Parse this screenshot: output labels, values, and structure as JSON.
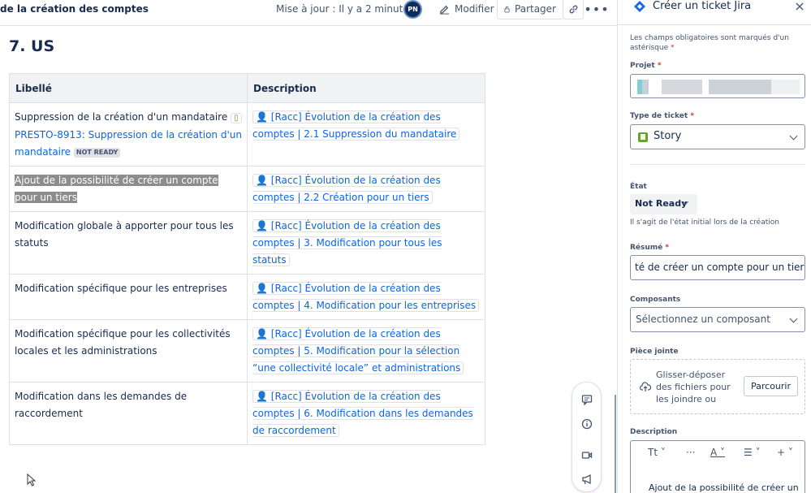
{
  "topbar": {
    "breadcrumb": "de la création des comptes",
    "updated": "Mise à jour : Il y a 2 minutes",
    "avatar_initials": "PN",
    "edit_label": "Modifier",
    "share_label": "Partager"
  },
  "section_title": "7. US",
  "table": {
    "headers": [
      "Libellé",
      "Description"
    ],
    "rows": [
      {
        "label": "Suppression de la création d'un mandataire",
        "ticket": "PRESTO-8913: Suppression de la création d'un mandataire",
        "ticket_status": "NOT READY",
        "desc_link": "👤 [Racc] Évolution de la création des comptes | 2.1 Suppression du mandataire"
      },
      {
        "label": "Ajout de la possibilité de créer un compte pour un tiers",
        "desc_link": "👤 [Racc] Évolution de la création des comptes | 2.2 Création pour un tiers"
      },
      {
        "label": "Modification globale à apporter pour tous les statuts",
        "desc_link": "👤 [Racc] Évolution de la création des comptes | 3. Modification pour tous les statuts"
      },
      {
        "label": "Modification spécifique pour les entreprises",
        "desc_link": "👤 [Racc] Évolution de la création des comptes | 4. Modification pour les entreprises"
      },
      {
        "label": "Modification spécifique pour les collectivités locales et les administrations",
        "desc_link": "👤 [Racc] Évolution de la création des comptes | 5. Modification pour la sélection “une collectivité locale” et administrations"
      },
      {
        "label": "Modification dans les demandes de raccordement",
        "desc_link": "👤 [Racc] Évolution de la création des comptes | 6. Modification dans les demandes de raccordement"
      }
    ]
  },
  "panel": {
    "title": "Créer un ticket Jira",
    "required_note": "Les champs obligatoires sont marqués d'un astérisque",
    "asterisk": "*",
    "project_label": "Projet",
    "ticket_type_label": "Type de ticket",
    "ticket_type_value": "Story",
    "state_label": "État",
    "state_value": "Not Ready",
    "state_hint": "Il s'agit de l'état initial lors de la création",
    "summary_label": "Résumé",
    "summary_value": "té de créer un compte pour un tiers",
    "components_label": "Composants",
    "components_placeholder": "Sélectionnez un composant",
    "attachment_label": "Pièce jointe",
    "attachment_drop": "Glisser-déposer des fichiers pour les joindre ou",
    "browse_label": "Parcourir",
    "description_label": "Description",
    "description_preview": "Ajout de la possibilité de créer un"
  },
  "colors": {
    "accent": "#0c66e4",
    "story_green": "#5fa630",
    "highlight": "#8c8c8c",
    "required": "#c9372c"
  },
  "icons": [
    "edit-icon",
    "lock-icon",
    "link-icon",
    "more-icon",
    "comment-icon",
    "info-icon",
    "video-icon",
    "megaphone-icon",
    "jira-icon",
    "close-icon",
    "upload-cloud-icon",
    "chevron-down-icon",
    "story-icon"
  ]
}
